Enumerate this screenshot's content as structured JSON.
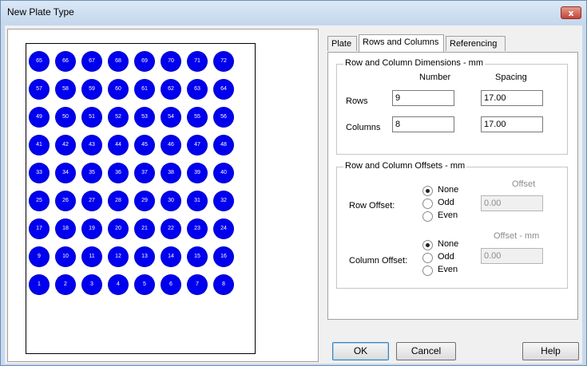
{
  "window": {
    "title": "New Plate Type",
    "close_glyph": "x"
  },
  "tabs": [
    {
      "label": "Plate",
      "active": false
    },
    {
      "label": "Rows and Columns",
      "active": true
    },
    {
      "label": "Referencing",
      "active": false
    }
  ],
  "dimensions": {
    "title": "Row and Column Dimensions - mm",
    "col_number": "Number",
    "col_spacing": "Spacing",
    "rows_label": "Rows",
    "rows_number": "9",
    "rows_spacing": "17.00",
    "columns_label": "Columns",
    "columns_number": "8",
    "columns_spacing": "17.00"
  },
  "offsets": {
    "title": "Row and Column Offsets - mm",
    "row_offset_label": "Row Offset:",
    "row_offset_header": "Offset",
    "row_offset_value": "0.00",
    "column_offset_label": "Column Offset:",
    "column_offset_header": "Offset - mm",
    "column_offset_value": "0.00",
    "options": [
      "None",
      "Odd",
      "Even"
    ],
    "row_selected": "None",
    "column_selected": "None"
  },
  "buttons": {
    "ok": "OK",
    "cancel": "Cancel",
    "help": "Help"
  },
  "plate": {
    "well_color": "#0000ee",
    "well_rows": [
      [
        "65",
        "66",
        "67",
        "68",
        "69",
        "70",
        "71",
        "72"
      ],
      [
        "57",
        "58",
        "59",
        "60",
        "61",
        "62",
        "63",
        "64"
      ],
      [
        "49",
        "50",
        "51",
        "52",
        "53",
        "54",
        "55",
        "56"
      ],
      [
        "41",
        "42",
        "43",
        "44",
        "45",
        "46",
        "47",
        "48"
      ],
      [
        "33",
        "34",
        "35",
        "36",
        "37",
        "38",
        "39",
        "40"
      ],
      [
        "25",
        "26",
        "27",
        "28",
        "29",
        "30",
        "31",
        "32"
      ],
      [
        "17",
        "18",
        "19",
        "20",
        "21",
        "22",
        "23",
        "24"
      ],
      [
        "9",
        "10",
        "11",
        "12",
        "13",
        "14",
        "15",
        "16"
      ],
      [
        "1",
        "2",
        "3",
        "4",
        "5",
        "6",
        "7",
        "8"
      ]
    ]
  }
}
